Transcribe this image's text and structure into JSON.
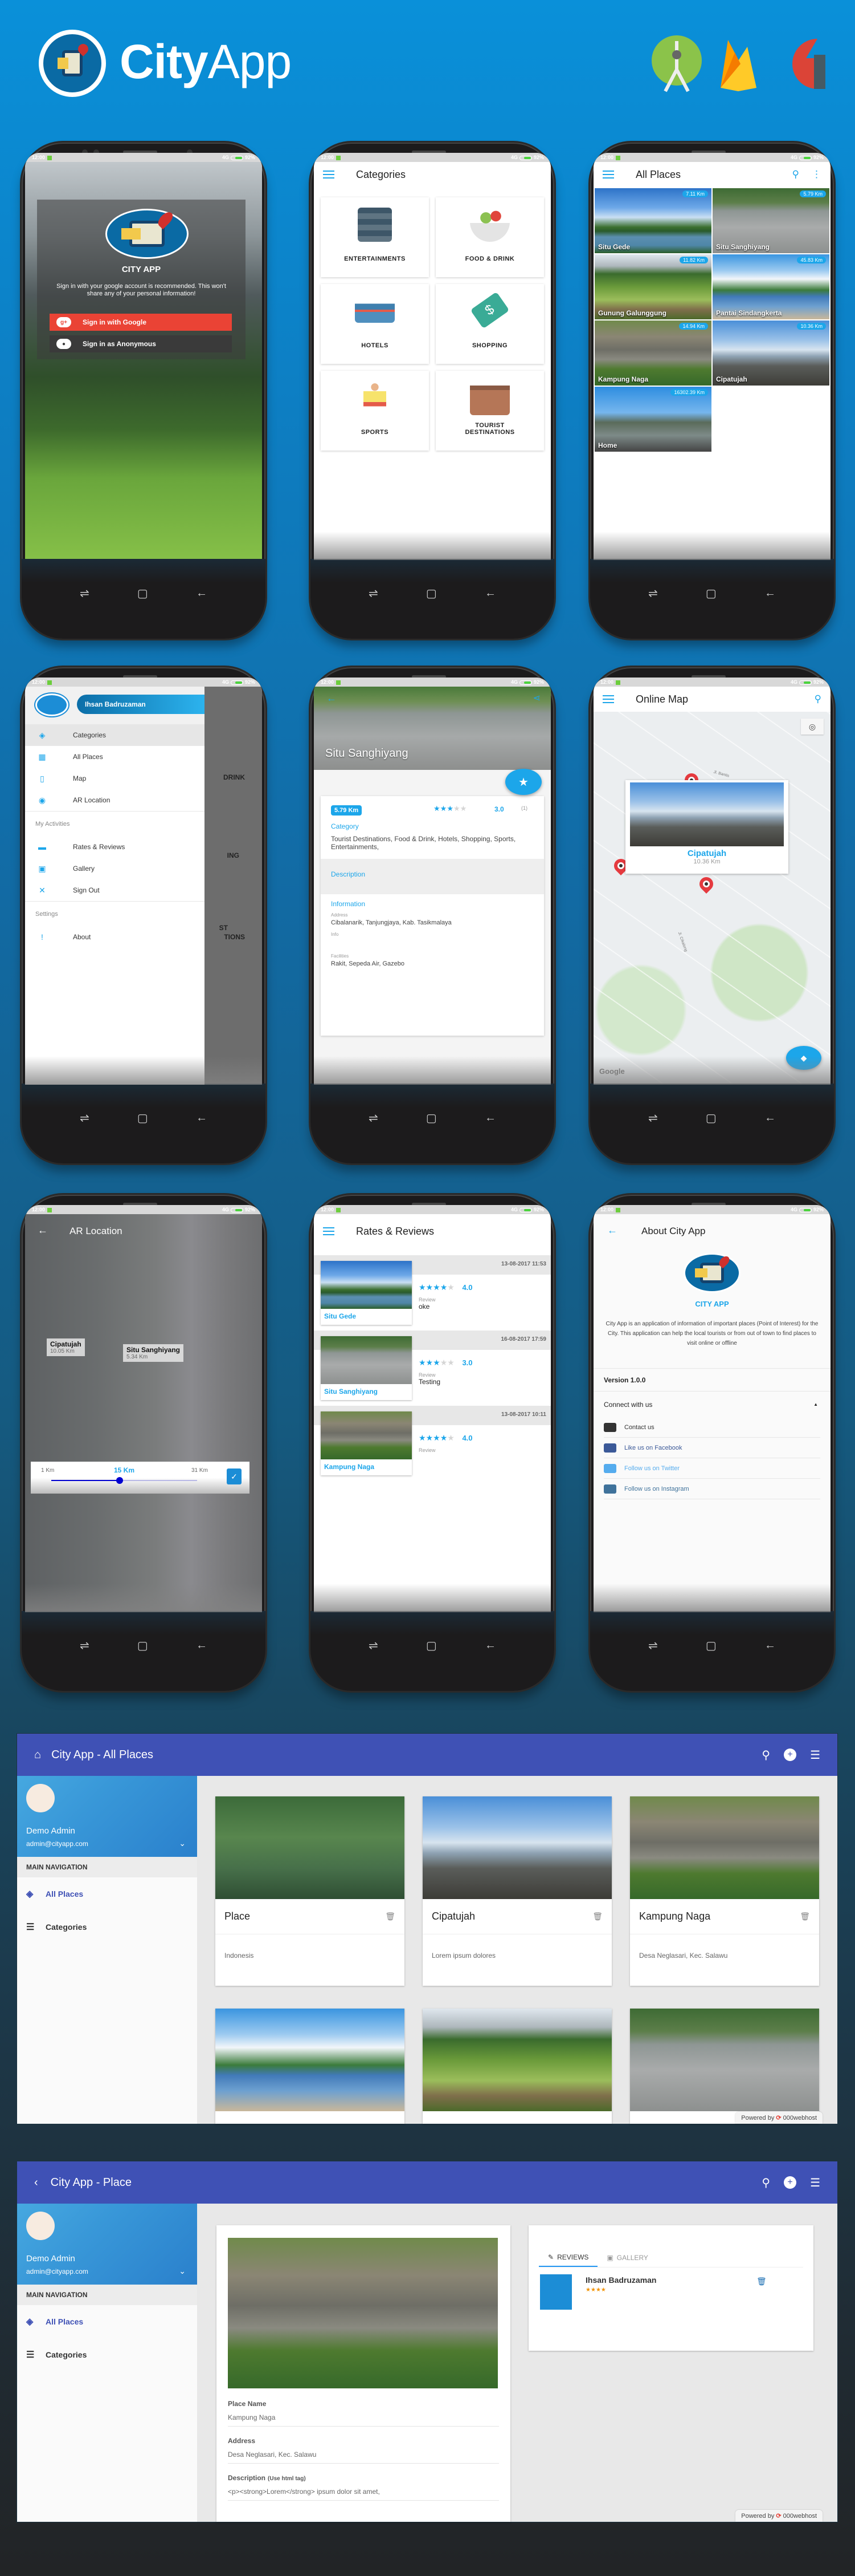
{
  "header": {
    "brand_bold": "City",
    "brand_light": "App",
    "tech_icons": [
      "android-studio-icon",
      "firebase-icon",
      "google-cloud-icon"
    ]
  },
  "status_bar": {
    "time": "12:00",
    "network": "4G",
    "battery": "92%"
  },
  "login": {
    "app_name": "CITY APP",
    "message": "Sign in with your google account is recommended. This won't share any of your personal information!",
    "google_button": "Sign in with Google",
    "google_icon": "g+",
    "anonymous_button": "Sign in as Anonymous"
  },
  "categories": {
    "title": "Categories",
    "items": [
      {
        "label": "ENTERTAINMENTS",
        "icon": "film-icon",
        "color": "#3d5668"
      },
      {
        "label": "FOOD & DRINK",
        "icon": "food-bowl-icon",
        "color": "#e0463c"
      },
      {
        "label": "HOTELS",
        "icon": "bed-icon",
        "color": "#3f7fae"
      },
      {
        "label": "SHOPPING",
        "icon": "price-tag-icon",
        "color": "#3aab96"
      },
      {
        "label": "SPORTS",
        "icon": "athlete-icon",
        "color": "#f2c94c"
      },
      {
        "label": "TOURIST DESTINATIONS",
        "icon": "briefcase-icon",
        "color": "#a86a4f"
      }
    ]
  },
  "all_places": {
    "title": "All Places",
    "items": [
      {
        "name": "Situ Gede",
        "distance": "7.11 Km"
      },
      {
        "name": "Situ Sanghiyang",
        "distance": "5.79 Km"
      },
      {
        "name": "Gunung Galunggung",
        "distance": "11.82 Km"
      },
      {
        "name": "Pantai Sindangkerta",
        "distance": "45.83 Km"
      },
      {
        "name": "Kampung Naga",
        "distance": "14.94 Km"
      },
      {
        "name": "Cipatujah",
        "distance": "10.36 Km"
      },
      {
        "name": "Home",
        "distance": "16302.39 Km"
      }
    ]
  },
  "drawer": {
    "user_name": "Ihsan Badruzaman",
    "main_items": [
      {
        "label": "Categories",
        "icon": "layers-icon",
        "glyph": "◈",
        "active": true
      },
      {
        "label": "All Places",
        "icon": "grid-icon",
        "glyph": "▦",
        "active": false
      },
      {
        "label": "Map",
        "icon": "map-icon",
        "glyph": "▯",
        "active": false
      },
      {
        "label": "AR Location",
        "icon": "eye-icon",
        "glyph": "◉",
        "active": false
      }
    ],
    "activities_header": "My Activities",
    "activity_items": [
      {
        "label": "Rates & Reviews",
        "icon": "chat-icon",
        "glyph": "▬"
      },
      {
        "label": "Gallery",
        "icon": "gallery-icon",
        "glyph": "▣"
      },
      {
        "label": "Sign Out",
        "icon": "close-circle-icon",
        "glyph": "✕"
      }
    ],
    "settings_header": "Settings",
    "settings_items": [
      {
        "label": "About",
        "icon": "info-icon",
        "glyph": "!"
      }
    ],
    "background_labels": [
      "DRINK",
      "ING",
      "ST",
      "TIONS"
    ]
  },
  "place_detail": {
    "title": "Situ Sanghiyang",
    "distance": "5.79 Km",
    "rating": 3,
    "rating_max": 5,
    "rating_text": "3.0",
    "rating_count": "(1)",
    "category_label": "Category",
    "category_value": "Tourist Destinations, Food & Drink, Hotels, Shopping, Sports, Entertainments,",
    "description_label": "Description",
    "information_label": "Information",
    "address_label": "Address",
    "address_value": "Cibalanarik, Tanjungjaya, Kab. Tasikmalaya",
    "info_label": "Info",
    "facilities_label": "Facilities",
    "facilities_value": "Rakit, Sepeda Air, Gazebo"
  },
  "online_map": {
    "title": "Online Map",
    "popup_name": "Cipatujah",
    "popup_distance": "10.36 Km",
    "street_labels": [
      "Jl. Bantis",
      "Jl. Cikalong"
    ],
    "attribution": "Google"
  },
  "ar_location": {
    "title": "AR Location",
    "markers": [
      {
        "name": "Cipatujah",
        "distance": "10.05 Km"
      },
      {
        "name": "Situ Sanghiyang",
        "distance": "5.34 Km"
      }
    ],
    "range_min": "1 Km",
    "range_value": "15 Km",
    "range_max": "31 Km",
    "range_fraction": 0.467
  },
  "rates_reviews": {
    "title": "Rates & Reviews",
    "review_label": "Review",
    "items": [
      {
        "place": "Situ Gede",
        "datetime": "13-08-2017 11:53",
        "rating": 4,
        "rating_text": "4.0",
        "review": "oke"
      },
      {
        "place": "Situ Sanghiyang",
        "datetime": "16-08-2017 17:59",
        "rating": 3,
        "rating_text": "3.0",
        "review": "Testing"
      },
      {
        "place": "Kampung Naga",
        "datetime": "13-08-2017 10:11",
        "rating": 4,
        "rating_text": "4.0",
        "review": ""
      }
    ]
  },
  "about": {
    "title": "About City App",
    "app_name": "CITY APP",
    "description": "City App is an application of information of important places (Point of Interest) for the City. This application can help the local tourists or from out of town to find places to visit online or offline",
    "version": "Version 1.0.0",
    "connect_label": "Connect with us",
    "links": [
      {
        "label": "Contact us",
        "icon": "mail-icon",
        "color": "#333333"
      },
      {
        "label": "Like us on Facebook",
        "icon": "facebook-icon",
        "color": "#3b5998"
      },
      {
        "label": "Follow us on Twitter",
        "icon": "twitter-icon",
        "color": "#55acee"
      },
      {
        "label": "Follow us on Instagram",
        "icon": "instagram-icon",
        "color": "#3f729b"
      }
    ]
  },
  "web_all_places": {
    "title": "City App - All Places",
    "admin_name": "Demo Admin",
    "admin_email": "admin@cityapp.com",
    "nav_header": "MAIN NAVIGATION",
    "nav_items": [
      {
        "label": "All Places",
        "active": true
      },
      {
        "label": "Categories",
        "active": false
      }
    ],
    "cards": [
      {
        "title": "Place",
        "subtitle": "Indonesis"
      },
      {
        "title": "Cipatujah",
        "subtitle": "Lorem ipsum dolores"
      },
      {
        "title": "Kampung Naga",
        "subtitle": "Desa Neglasari, Kec. Salawu"
      }
    ],
    "powered_by": "Powered by",
    "host": "000webhost"
  },
  "web_place": {
    "title": "City App - Place",
    "admin_name": "Demo Admin",
    "admin_email": "admin@cityapp.com",
    "nav_header": "MAIN NAVIGATION",
    "nav_items": [
      {
        "label": "All Places",
        "active": true
      },
      {
        "label": "Categories",
        "active": false
      }
    ],
    "fields": [
      {
        "label": "Place Name",
        "hint": "",
        "value": "Kampung Naga"
      },
      {
        "label": "Address",
        "hint": "",
        "value": "Desa Neglasari, Kec. Salawu"
      },
      {
        "label": "Description",
        "hint": "(Use html tag)",
        "value": "<p><strong>Lorem</strong> ipsum dolor sit amet,"
      }
    ],
    "tabs": [
      {
        "label": "REVIEWS",
        "active": true
      },
      {
        "label": "GALLERY",
        "active": false
      }
    ],
    "reviewer": "Ihsan Badruzaman",
    "reviewer_rating": 4,
    "powered_by": "Powered by",
    "host": "000webhost"
  }
}
